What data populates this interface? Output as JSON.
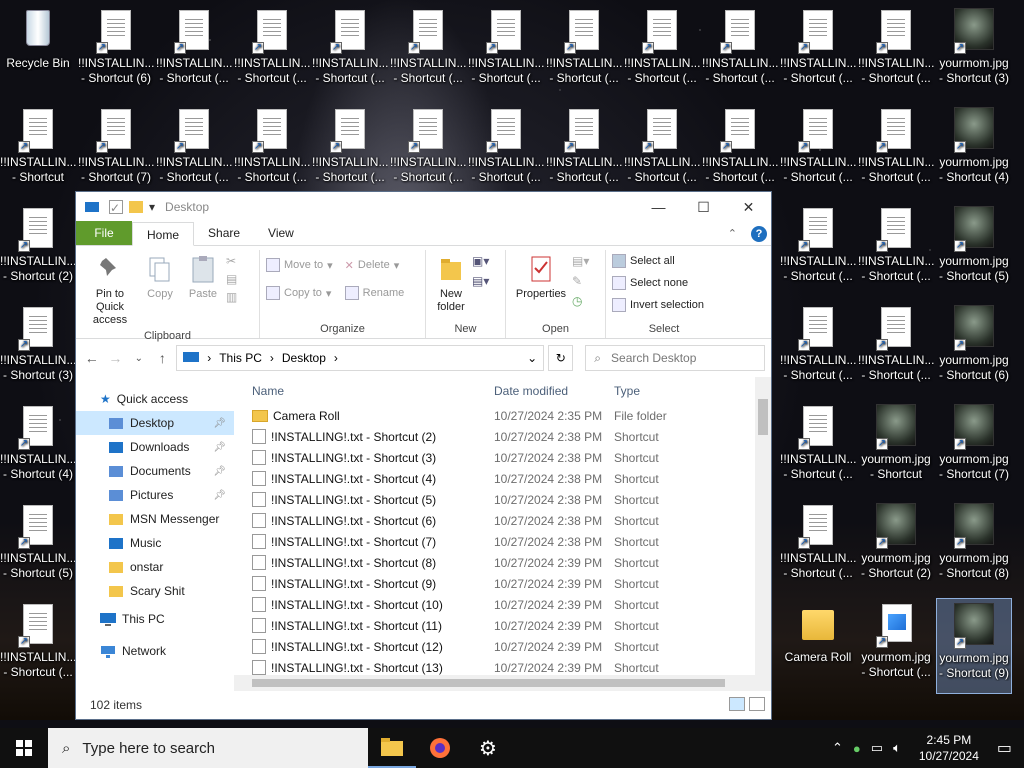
{
  "desktop": {
    "icons": [
      {
        "label": "Recycle Bin",
        "kind": "bin",
        "x": 0,
        "y": 0
      },
      {
        "label": "!!INSTALLIN... - Shortcut (6)",
        "kind": "doc",
        "x": 1,
        "y": 0
      },
      {
        "label": "!!INSTALLIN... - Shortcut (...",
        "kind": "doc",
        "x": 2,
        "y": 0
      },
      {
        "label": "!!INSTALLIN... - Shortcut (...",
        "kind": "doc",
        "x": 3,
        "y": 0
      },
      {
        "label": "!!INSTALLIN... - Shortcut (...",
        "kind": "doc",
        "x": 4,
        "y": 0
      },
      {
        "label": "!!INSTALLIN... - Shortcut (...",
        "kind": "doc",
        "x": 5,
        "y": 0
      },
      {
        "label": "!!INSTALLIN... - Shortcut (...",
        "kind": "doc",
        "x": 6,
        "y": 0
      },
      {
        "label": "!!INSTALLIN... - Shortcut (...",
        "kind": "doc",
        "x": 7,
        "y": 0
      },
      {
        "label": "!!INSTALLIN... - Shortcut (...",
        "kind": "doc",
        "x": 8,
        "y": 0
      },
      {
        "label": "!!INSTALLIN... - Shortcut (...",
        "kind": "doc",
        "x": 9,
        "y": 0
      },
      {
        "label": "!!INSTALLIN... - Shortcut (...",
        "kind": "doc",
        "x": 10,
        "y": 0
      },
      {
        "label": "!!INSTALLIN... - Shortcut (...",
        "kind": "doc",
        "x": 11,
        "y": 0
      },
      {
        "label": "yourmom.jpg - Shortcut (3)",
        "kind": "face",
        "x": 12,
        "y": 0
      },
      {
        "label": "!!INSTALLIN... - Shortcut",
        "kind": "doc",
        "x": 0,
        "y": 1
      },
      {
        "label": "!!INSTALLIN... - Shortcut (7)",
        "kind": "doc",
        "x": 1,
        "y": 1
      },
      {
        "label": "!!INSTALLIN... - Shortcut (...",
        "kind": "doc",
        "x": 2,
        "y": 1
      },
      {
        "label": "!!INSTALLIN... - Shortcut (...",
        "kind": "doc",
        "x": 3,
        "y": 1
      },
      {
        "label": "!!INSTALLIN... - Shortcut (...",
        "kind": "doc",
        "x": 4,
        "y": 1
      },
      {
        "label": "!!INSTALLIN... - Shortcut (...",
        "kind": "doc",
        "x": 5,
        "y": 1
      },
      {
        "label": "!!INSTALLIN... - Shortcut (...",
        "kind": "doc",
        "x": 6,
        "y": 1
      },
      {
        "label": "!!INSTALLIN... - Shortcut (...",
        "kind": "doc",
        "x": 7,
        "y": 1
      },
      {
        "label": "!!INSTALLIN... - Shortcut (...",
        "kind": "doc",
        "x": 8,
        "y": 1
      },
      {
        "label": "!!INSTALLIN... - Shortcut (...",
        "kind": "doc",
        "x": 9,
        "y": 1
      },
      {
        "label": "!!INSTALLIN... - Shortcut (...",
        "kind": "doc",
        "x": 10,
        "y": 1
      },
      {
        "label": "!!INSTALLIN... - Shortcut (...",
        "kind": "doc",
        "x": 11,
        "y": 1
      },
      {
        "label": "yourmom.jpg - Shortcut (4)",
        "kind": "face",
        "x": 12,
        "y": 1
      },
      {
        "label": "!!INSTALLIN... - Shortcut (2)",
        "kind": "doc",
        "x": 0,
        "y": 2
      },
      {
        "label": "!!INSTALLIN... - Shortcut (...",
        "kind": "doc",
        "x": 10,
        "y": 2
      },
      {
        "label": "!!INSTALLIN... - Shortcut (...",
        "kind": "doc",
        "x": 11,
        "y": 2
      },
      {
        "label": "yourmom.jpg - Shortcut (5)",
        "kind": "face",
        "x": 12,
        "y": 2
      },
      {
        "label": "!!INSTALLIN... - Shortcut (3)",
        "kind": "doc",
        "x": 0,
        "y": 3
      },
      {
        "label": "!!INSTALLIN... - Shortcut (...",
        "kind": "doc",
        "x": 10,
        "y": 3
      },
      {
        "label": "!!INSTALLIN... - Shortcut (...",
        "kind": "doc",
        "x": 11,
        "y": 3
      },
      {
        "label": "yourmom.jpg - Shortcut (6)",
        "kind": "face",
        "x": 12,
        "y": 3
      },
      {
        "label": "!!INSTALLIN... - Shortcut (4)",
        "kind": "doc",
        "x": 0,
        "y": 4
      },
      {
        "label": "!!INSTALLIN... - Shortcut (...",
        "kind": "doc",
        "x": 10,
        "y": 4
      },
      {
        "label": "yourmom.jpg - Shortcut",
        "kind": "face",
        "x": 11,
        "y": 4
      },
      {
        "label": "yourmom.jpg - Shortcut (7)",
        "kind": "face",
        "x": 12,
        "y": 4
      },
      {
        "label": "!!INSTALLIN... - Shortcut (5)",
        "kind": "doc",
        "x": 0,
        "y": 5
      },
      {
        "label": "!!INSTALLIN... - Shortcut (...",
        "kind": "doc",
        "x": 10,
        "y": 5
      },
      {
        "label": "yourmom.jpg - Shortcut (2)",
        "kind": "face",
        "x": 11,
        "y": 5
      },
      {
        "label": "yourmom.jpg - Shortcut (8)",
        "kind": "face",
        "x": 12,
        "y": 5
      },
      {
        "label": "!!INSTALLIN... - Shortcut (...",
        "kind": "doc",
        "x": 0,
        "y": 6
      },
      {
        "label": "Camera Roll",
        "kind": "folder",
        "x": 10,
        "y": 6
      },
      {
        "label": "yourmom.jpg - Shortcut (...",
        "kind": "jpg",
        "x": 11,
        "y": 6
      },
      {
        "label": "yourmom.jpg - Shortcut (9)",
        "kind": "face",
        "x": 12,
        "y": 6,
        "selected": true
      }
    ]
  },
  "explorer": {
    "title": "Desktop",
    "controls": {
      "minimize": "—",
      "maximize": "☐",
      "close": "✕"
    },
    "tabs": {
      "file": "File",
      "home": "Home",
      "share": "Share",
      "view": "View"
    },
    "ribbon": {
      "clipboard": {
        "name": "Clipboard",
        "pin": "Pin to Quick access",
        "copy": "Copy",
        "paste": "Paste"
      },
      "organize": {
        "name": "Organize",
        "move_to": "Move to",
        "copy_to": "Copy to",
        "delete": "Delete",
        "rename": "Rename"
      },
      "new": {
        "name": "New",
        "new_folder": "New folder"
      },
      "open": {
        "name": "Open",
        "properties": "Properties"
      },
      "select": {
        "name": "Select",
        "select_all": "Select all",
        "select_none": "Select none",
        "invert": "Invert selection"
      }
    },
    "address": {
      "root": "This PC",
      "current": "Desktop",
      "separator": "›"
    },
    "search": {
      "placeholder": "Search Desktop"
    },
    "navpane": {
      "quick_access": "Quick access",
      "items": [
        {
          "label": "Desktop",
          "pinned": true,
          "selected": true,
          "icon": "desktop-icon"
        },
        {
          "label": "Downloads",
          "pinned": true,
          "icon": "download-icon"
        },
        {
          "label": "Documents",
          "pinned": true,
          "icon": "documents-icon"
        },
        {
          "label": "Pictures",
          "pinned": true,
          "icon": "pictures-icon"
        },
        {
          "label": "MSN Messenger",
          "icon": "folder-icon"
        },
        {
          "label": "Music",
          "icon": "music-icon"
        },
        {
          "label": "onstar",
          "icon": "folder-icon"
        },
        {
          "label": "Scary Shit",
          "icon": "folder-icon"
        }
      ],
      "this_pc": "This PC",
      "network": "Network"
    },
    "columns": {
      "name": "Name",
      "date": "Date modified",
      "type": "Type"
    },
    "files": [
      {
        "name": "Camera Roll",
        "date": "10/27/2024 2:35 PM",
        "type": "File folder",
        "folder": true
      },
      {
        "name": "!INSTALLING!.txt - Shortcut (2)",
        "date": "10/27/2024 2:38 PM",
        "type": "Shortcut"
      },
      {
        "name": "!INSTALLING!.txt - Shortcut (3)",
        "date": "10/27/2024 2:38 PM",
        "type": "Shortcut"
      },
      {
        "name": "!INSTALLING!.txt - Shortcut (4)",
        "date": "10/27/2024 2:38 PM",
        "type": "Shortcut"
      },
      {
        "name": "!INSTALLING!.txt - Shortcut (5)",
        "date": "10/27/2024 2:38 PM",
        "type": "Shortcut"
      },
      {
        "name": "!INSTALLING!.txt - Shortcut (6)",
        "date": "10/27/2024 2:38 PM",
        "type": "Shortcut"
      },
      {
        "name": "!INSTALLING!.txt - Shortcut (7)",
        "date": "10/27/2024 2:38 PM",
        "type": "Shortcut"
      },
      {
        "name": "!INSTALLING!.txt - Shortcut (8)",
        "date": "10/27/2024 2:39 PM",
        "type": "Shortcut"
      },
      {
        "name": "!INSTALLING!.txt - Shortcut (9)",
        "date": "10/27/2024 2:39 PM",
        "type": "Shortcut"
      },
      {
        "name": "!INSTALLING!.txt - Shortcut (10)",
        "date": "10/27/2024 2:39 PM",
        "type": "Shortcut"
      },
      {
        "name": "!INSTALLING!.txt - Shortcut (11)",
        "date": "10/27/2024 2:39 PM",
        "type": "Shortcut"
      },
      {
        "name": "!INSTALLING!.txt - Shortcut (12)",
        "date": "10/27/2024 2:39 PM",
        "type": "Shortcut"
      },
      {
        "name": "!INSTALLING!.txt - Shortcut (13)",
        "date": "10/27/2024 2:39 PM",
        "type": "Shortcut"
      }
    ],
    "status": "102 items"
  },
  "taskbar": {
    "search_placeholder": "Type here to search",
    "apps": [
      "file-explorer-icon",
      "firefox-icon",
      "settings-icon"
    ],
    "time": "2:45 PM",
    "date": "10/27/2024"
  }
}
